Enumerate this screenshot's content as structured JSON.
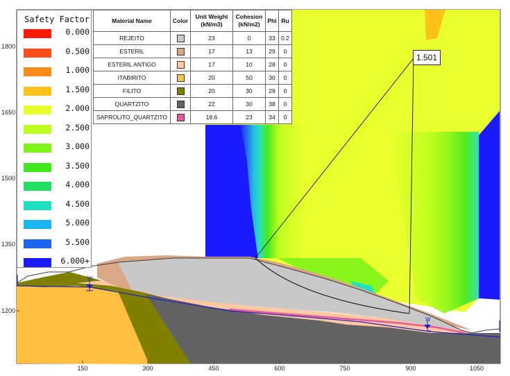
{
  "legend": {
    "title": "Safety Factor",
    "items": [
      {
        "label": "0.000",
        "color": "#ff1a00"
      },
      {
        "label": "0.500",
        "color": "#ff4d1a"
      },
      {
        "label": "1.000",
        "color": "#ff8c1a"
      },
      {
        "label": "1.500",
        "color": "#ffc21a"
      },
      {
        "label": "2.000",
        "color": "#e9ff2e"
      },
      {
        "label": "2.500",
        "color": "#bfff1f"
      },
      {
        "label": "3.000",
        "color": "#7df41a"
      },
      {
        "label": "3.500",
        "color": "#3fe81a"
      },
      {
        "label": "4.000",
        "color": "#1fe060"
      },
      {
        "label": "4.500",
        "color": "#1fe0c0"
      },
      {
        "label": "5.000",
        "color": "#1ab4f0"
      },
      {
        "label": "5.500",
        "color": "#1a64f0"
      },
      {
        "label": "6.000+",
        "color": "#1a1aff"
      }
    ]
  },
  "materials": {
    "headers": {
      "name": "Material Name",
      "color": "Color",
      "unit_weight": [
        "Unit Weight",
        "(kN/m3)"
      ],
      "cohesion": [
        "Cohesion",
        "(kN/m2)"
      ],
      "phi": "Phi",
      "ru": "Ru"
    },
    "rows": [
      {
        "name": "REJEITO",
        "color": "#c8c8c8",
        "unit_weight": "23",
        "cohesion": "0",
        "phi": "33",
        "ru": "0.2"
      },
      {
        "name": "ESTERIL",
        "color": "#d9a884",
        "unit_weight": "17",
        "cohesion": "13",
        "phi": "29",
        "ru": "0"
      },
      {
        "name": "ESTERIL ANTIGO",
        "color": "#ffc8a0",
        "unit_weight": "17",
        "cohesion": "10",
        "phi": "28",
        "ru": "0"
      },
      {
        "name": "ITABIRITO",
        "color": "#f3c24f",
        "unit_weight": "20",
        "cohesion": "50",
        "phi": "30",
        "ru": "0"
      },
      {
        "name": "FILITO",
        "color": "#808000",
        "unit_weight": "20",
        "cohesion": "30",
        "phi": "29",
        "ru": "0"
      },
      {
        "name": "QUARTZITO",
        "color": "#636363",
        "unit_weight": "22",
        "cohesion": "30",
        "phi": "38",
        "ru": "0"
      },
      {
        "name": "SAPROLITO_QUARTZITO",
        "color": "#e8589a",
        "unit_weight": "18.6",
        "cohesion": "23",
        "phi": "34",
        "ru": "0"
      }
    ]
  },
  "axes": {
    "y_ticks": [
      "1800",
      "1650",
      "1500",
      "1350",
      "1200"
    ],
    "x_ticks": [
      "150",
      "300",
      "450",
      "600",
      "750",
      "900",
      "1050"
    ]
  },
  "result": {
    "safety_factor": "1.501"
  },
  "markers": {
    "water_label": "W"
  }
}
